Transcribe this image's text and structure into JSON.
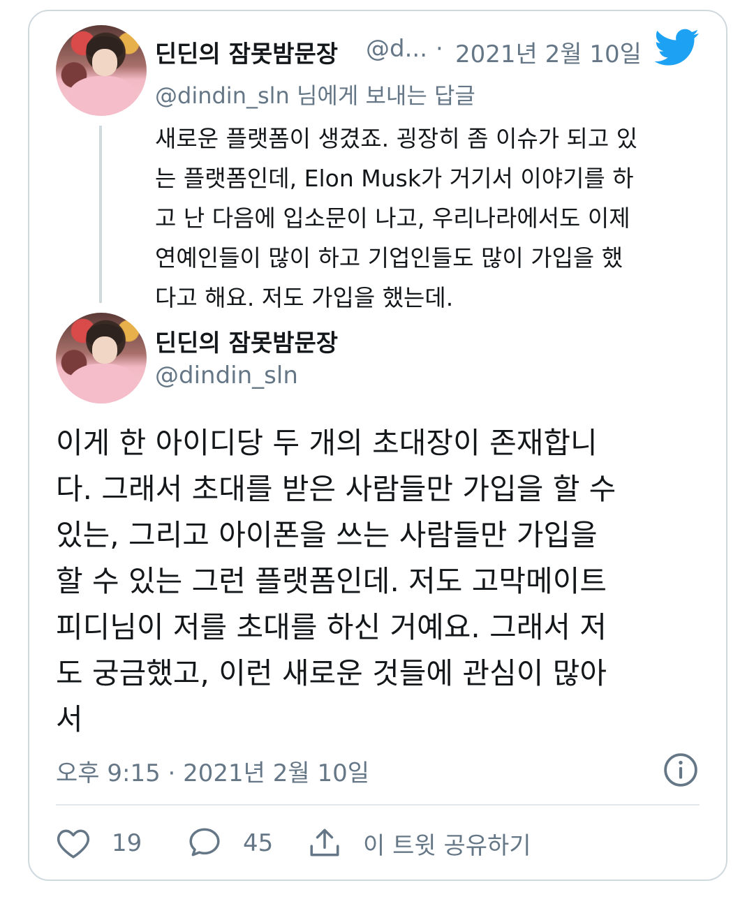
{
  "reply_tweet": {
    "display_name": "딘딘의 잠못밤문장",
    "handle_truncated": "@d...",
    "date_separator": "·",
    "date": "2021년 2월 10일",
    "reply_to_prefix": "@dindin_sln",
    "reply_to_suffix": " 님에게 보내는 답글",
    "body_lines": [
      "새로운 플랫폼이 생겼죠. 굉장히 좀 이슈가 되고 있",
      "는 플랫폼인데, Elon Musk가 거기서 이야기를 하",
      "고 난 다음에 입소문이 나고, 우리나라에서도 이제",
      "연예인들이 많이 하고 기업인들도 많이 가입을 했",
      "다고 해요. 저도 가입을 했는데."
    ]
  },
  "main_tweet": {
    "display_name": "딘딘의 잠못밤문장",
    "handle": "@dindin_sln",
    "body_lines": [
      "이게 한 아이디당 두 개의 초대장이 존재합니",
      "다. 그래서 초대를 받은 사람들만 가입을 할 수",
      "있는, 그리고 아이폰을 쓰는 사람들만 가입을",
      "할 수 있는 그런 플랫폼인데. 저도 고막메이트",
      "피디님이 저를 초대를 하신 거예요. 그래서 저",
      "도 궁금했고, 이런 새로운 것들에 관심이 많아",
      "서"
    ],
    "timestamp": "오후 9:15 · 2021년 2월 10일"
  },
  "actions": {
    "like_count": "19",
    "reply_count": "45",
    "share_label": "이 트윗 공유하기"
  },
  "colors": {
    "twitter_blue": "#1da1f2",
    "muted_text": "#657786",
    "border": "#cfd9de"
  }
}
